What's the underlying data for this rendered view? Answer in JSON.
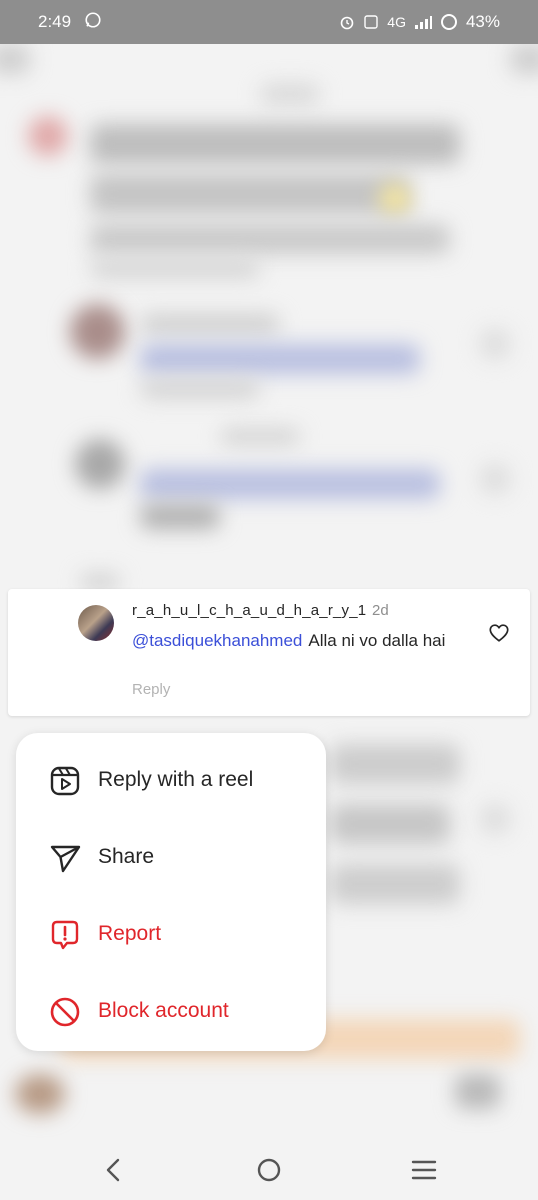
{
  "status_bar": {
    "time": "2:49",
    "network": "4G",
    "battery": "43%"
  },
  "comment": {
    "username": "r_a_h_u_l_c_h_a_u_d_h_a_r_y_1",
    "time_ago": "2d",
    "mention": "@tasdiquekhanahmed",
    "text": "Alla ni vo dalla hai",
    "reply_label": "Reply"
  },
  "menu": {
    "items": [
      {
        "label": "Reply with a reel",
        "icon": "reels-icon"
      },
      {
        "label": "Share",
        "icon": "send-icon"
      },
      {
        "label": "Report",
        "icon": "report-icon"
      },
      {
        "label": "Block account",
        "icon": "block-icon"
      }
    ]
  },
  "colors": {
    "accent": "#3b4fd8",
    "danger": "#e0262b",
    "text": "#262626",
    "muted": "#8e8e8e"
  }
}
